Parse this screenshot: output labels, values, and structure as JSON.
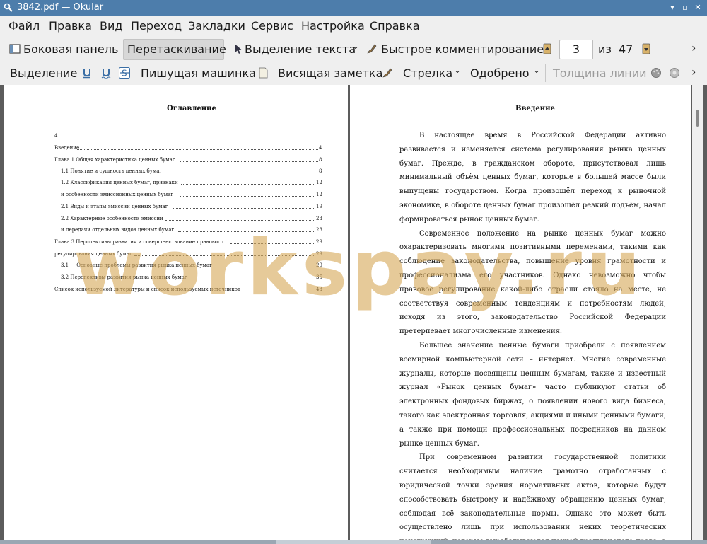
{
  "window": {
    "title": "3842.pdf  — Okular"
  },
  "menu": [
    "Файл",
    "Правка",
    "Вид",
    "Переход",
    "Закладки",
    "Сервис",
    "Настройка",
    "Справка"
  ],
  "toolbar1": {
    "sidebar": "Боковая панель",
    "drag": "Перетаскивание",
    "text_select": "Выделение текста",
    "quick_comment": "Быстрое комментирование",
    "page_current": "3",
    "page_of": "из",
    "page_total": "47"
  },
  "toolbar2": {
    "selection": "Выделение",
    "typewriter": "Пишущая машинка",
    "sticky_note": "Висящая заметка",
    "arrow": "Стрелка",
    "approved": "Одобрено",
    "line_width": "Толщина линии"
  },
  "left_page": {
    "heading": "Оглавление",
    "toc": [
      {
        "text": "4",
        "page": ""
      },
      {
        "text": "Введение",
        "page": "4"
      },
      {
        "text": "Глава 1 Общая характеристика ценных бумаг",
        "page": "8"
      },
      {
        "text": "1.1 Понятие и сущность ценных бумаг",
        "page": "8"
      },
      {
        "text": "1.2 Классификация ценных бумаг, признаки",
        "page": "12"
      },
      {
        "text": "и особенности эмиссионных ценных бумаг",
        "page": "12"
      },
      {
        "text": "2.1 Виды и этапы эмиссии ценных бумаг",
        "page": "19"
      },
      {
        "text": "2.2 Характерные особенности эмиссии",
        "page": "23"
      },
      {
        "text": "и передачи отдельных видов ценных бумаг",
        "page": "23"
      },
      {
        "text": "Глава 3 Перспективы развития и совершенствование правового",
        "page": "29"
      },
      {
        "text": "регулирования ценных бумаг",
        "page": "29"
      },
      {
        "text": "3.1     Основные проблемы развития рынка ценных бумаг",
        "page": "29"
      },
      {
        "text": "3.2 Перспективы развития рынка ценных бумаг",
        "page": "35"
      },
      {
        "text": "Список используемой литературы и список используемых источников",
        "page": "43"
      }
    ]
  },
  "right_page": {
    "heading": "Введение",
    "paragraphs": [
      "В настоящее время в Российской Федерации активно развивается и изменяется система регулирования рынка ценных бумаг. Прежде, в гражданском обороте, присутствовал лишь минимальный объём ценных бумаг, которые в большей массе были выпущены государством. Когда произошёл переход к рыночной экономике, в обороте ценных бумаг произошёл резкий подъём, начал формироваться рынок ценных бумаг.",
      "Современное положение на рынке ценных бумаг можно охарактеризовать многими позитивными переменами, такими как соблюдение законодательства, повышение уровня грамотности и профессионализма его участников. Однако невозможно чтобы правовое регулирование какой-либо отрасли стояло на месте, не соответствуя современным тенденциям и потребностям людей, исходя из этого, законодательство Российской Федерации претерпевает многочисленные изменения.",
      "Большее значение ценные бумаги приобрели с появлением всемирной компьютерной сети – интернет. Многие современные журналы, которые посвящены ценным бумагам, также и известный журнал «Рынок ценных бумаг» часто публикуют статьи об электронных фондовых биржах, о появлении нового вида бизнеса, такого как электронная торговля, акциями и иными ценными бумаги, а также при помощи профессиональных посредников на данном рынке ценных бумаг.",
      "При современном развитии государственной политики считается необходимым наличие грамотно отработанных с юридической точки зрения нормативных актов, которые будут способствовать быстрому и надёжному обращению ценных бумаг, соблюдая всё законодательные нормы. Однако это может быть осуществлено лишь при использовании неких теоретических конструкций, которые вырабатываются наукой гражданского права, а также"
    ]
  },
  "watermark": "workspay.ru"
}
